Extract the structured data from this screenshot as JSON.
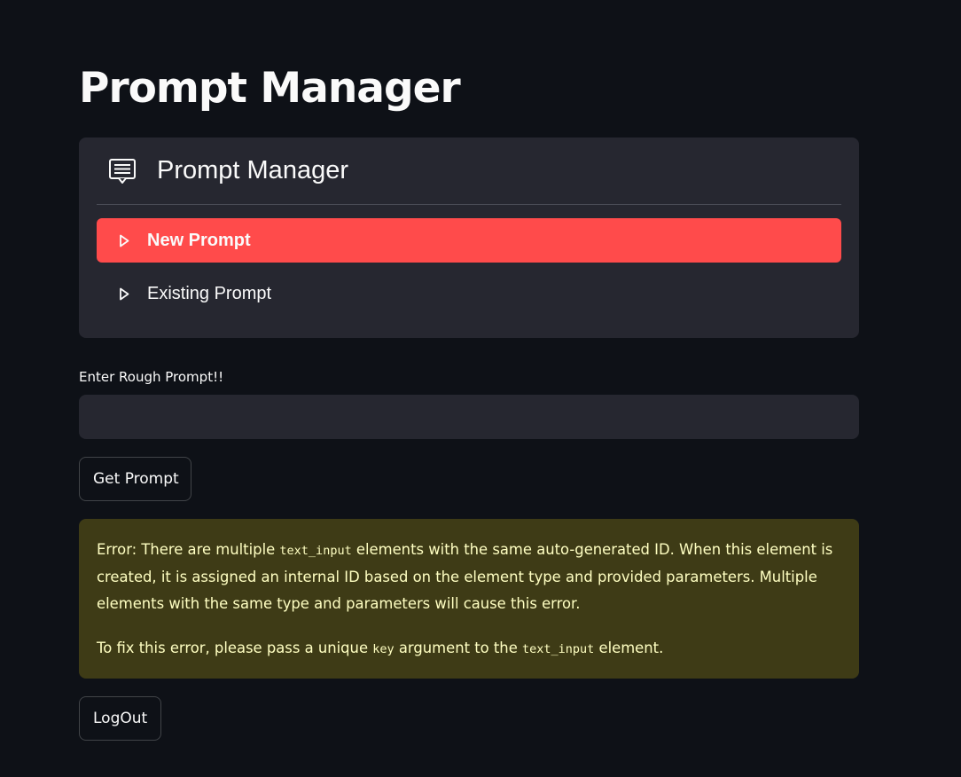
{
  "page": {
    "title": "Prompt Manager"
  },
  "menu": {
    "title": "Prompt Manager",
    "icon": "chat-lines-icon",
    "items": [
      {
        "label": "New Prompt",
        "icon": "caret-right-icon",
        "active": true
      },
      {
        "label": "Existing Prompt",
        "icon": "caret-right-icon",
        "active": false
      }
    ]
  },
  "form": {
    "input_label": "Enter Rough Prompt!!",
    "input_value": "",
    "submit_label": "Get Prompt"
  },
  "error": {
    "p1_a": "Error: There are multiple ",
    "p1_code": "text_input",
    "p1_b": " elements with the same auto-generated ID. When this element is created, it is assigned an internal ID based on the element type and provided parameters. Multiple elements with the same type and parameters will cause this error.",
    "p2_a": "To fix this error, please pass a unique ",
    "p2_code1": "key",
    "p2_b": " argument to the ",
    "p2_code2": "text_input",
    "p2_c": " element."
  },
  "logout": {
    "label": "LogOut"
  },
  "colors": {
    "background": "#0e1117",
    "card": "#262730",
    "accent": "#ff4b4b",
    "error_bg": "#3e3b16",
    "error_text": "#ffffc2"
  }
}
